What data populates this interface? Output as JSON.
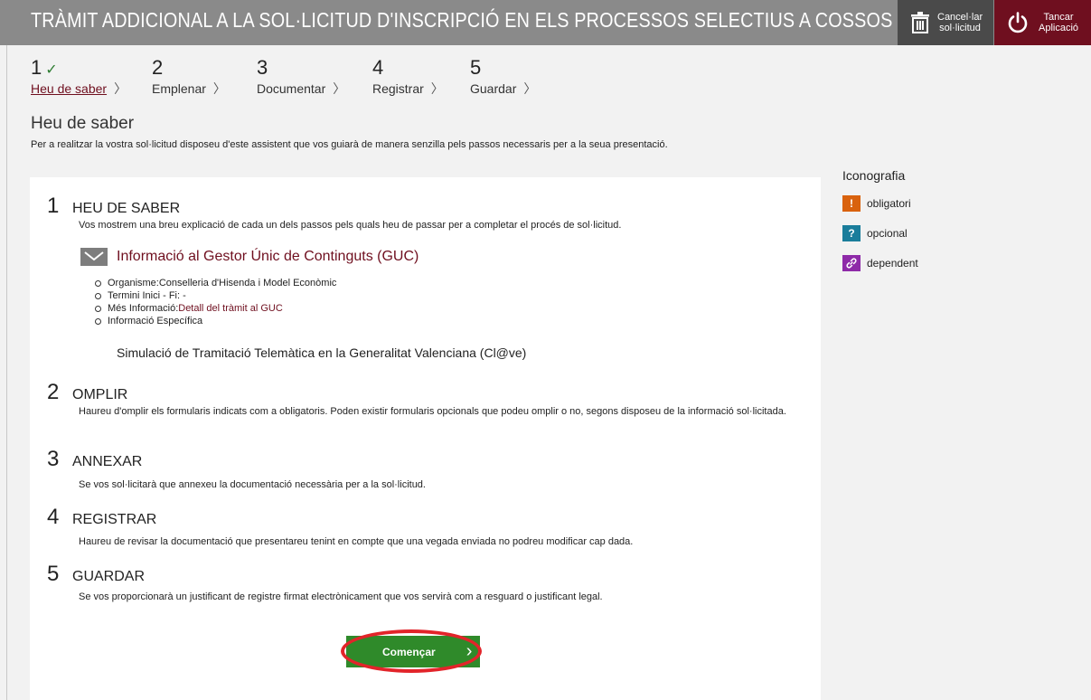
{
  "header": {
    "title": "TRÀMIT ADDICIONAL A LA SOL·LICITUD D'INSCRIPCIÓ EN ELS PROCESSOS SELECTIUS A COSSOS DOCENT",
    "cancel_line1": "Cancel·lar",
    "cancel_line2": "sol·licitud",
    "close_line1": "Tancar",
    "close_line2": "Aplicació",
    "cancel_icon": "trash-icon",
    "close_icon": "power-icon"
  },
  "steps": [
    {
      "num": "1",
      "check": "✓",
      "label": "Heu de saber",
      "active": true
    },
    {
      "num": "2",
      "label": "Emplenar"
    },
    {
      "num": "3",
      "label": "Documentar"
    },
    {
      "num": "4",
      "label": "Registrar"
    },
    {
      "num": "5",
      "label": "Guardar"
    }
  ],
  "page": {
    "section_title": "Heu de saber",
    "intro": "Per a realitzar la vostra sol·licitud disposeu d'este assistent que vos guiarà de manera senzilla pels passos necessaris per a la seua presentació."
  },
  "blocks": [
    {
      "num": "1",
      "title": "HEU DE SABER",
      "text": "Vos mostrem una breu explicació de cada un dels passos pels quals heu de passar per a completar el procés de sol·licitud."
    },
    {
      "num": "2",
      "title": "OMPLIR",
      "text": "Haureu d'omplir els formularis indicats com a obligatoris. Poden existir formularis opcionals que podeu omplir o no, segons disposeu de la informació sol·licitada."
    },
    {
      "num": "3",
      "title": "ANNEXAR",
      "text": "Se vos sol·licitarà que annexeu la documentació necessària per a la sol·licitud."
    },
    {
      "num": "4",
      "title": "REGISTRAR",
      "text": "Haureu de revisar la documentació que presentareu tenint en compte que una vegada enviada no podreu modificar cap dada."
    },
    {
      "num": "5",
      "title": "GUARDAR",
      "text": "Se vos proporcionarà un justificant de registre firmat electrònicament que vos servirà com a resguard o justificant legal."
    }
  ],
  "guc": {
    "title": "Informació al Gestor Únic de Continguts (GUC)",
    "icon": "envelope-icon",
    "org_label": "Organisme:",
    "org_value": "Conselleria d'Hisenda i Model Econòmic",
    "term": "Termini Inici - Fi: -",
    "more_label": "Més Informació:",
    "more_link": "Detall del tràmit al GUC",
    "specific": "Informació Específica",
    "simulation": "Simulació de Tramitació Telemàtica en la Generalitat Valenciana (Cl@ve)"
  },
  "start_button": {
    "label": "Començar",
    "chevron": "›"
  },
  "iconography": {
    "title": "Iconografia",
    "items": [
      {
        "symbol": "!",
        "label": "obligatori",
        "color": "#d9620e"
      },
      {
        "symbol": "?",
        "label": "opcional",
        "color": "#1a7d9b"
      },
      {
        "symbol": "🔗",
        "label": "dependent",
        "color": "#8e2aa8"
      }
    ]
  },
  "colors": {
    "accent": "#6f0f1f",
    "header": "#8a8a8a",
    "start": "#2f8a2a",
    "highlight": "#e2242a"
  }
}
